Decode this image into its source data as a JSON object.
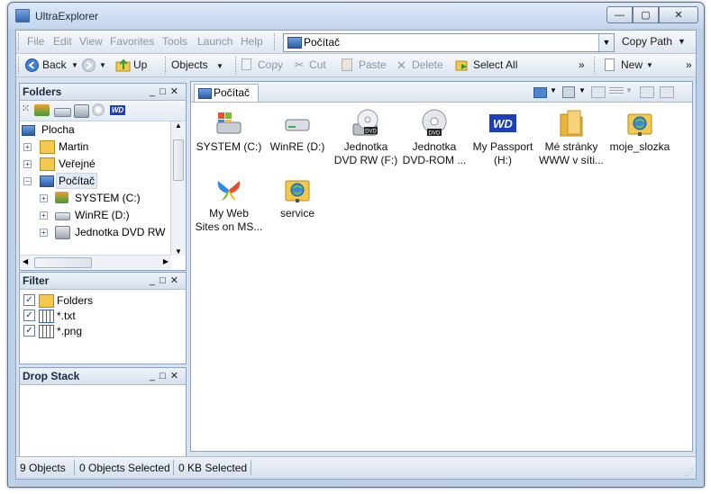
{
  "window": {
    "title": "UltraExplorer",
    "minimize": "—",
    "maximize": "▢",
    "close": "✕"
  },
  "menu": {
    "items": [
      "File",
      "Edit",
      "View",
      "Favorites",
      "Tools",
      "Launch",
      "Help"
    ]
  },
  "address": {
    "value": "Počítač",
    "copy_path": "Copy Path",
    "dropdown": "▼"
  },
  "toolbar": {
    "back": "Back",
    "up": "Up",
    "objects": "Objects",
    "copy": "Copy",
    "cut": "Cut",
    "paste": "Paste",
    "delete": "Delete",
    "select_all": "Select All",
    "new": "New",
    "more": "»"
  },
  "folders_panel": {
    "title": "Folders",
    "nodes": [
      {
        "label": "Plocha",
        "icon": "desktop-icon"
      },
      {
        "label": "Martin",
        "icon": "user-folder-icon"
      },
      {
        "label": "Veřejné",
        "icon": "folder-icon"
      },
      {
        "label": "Počítač",
        "icon": "computer-icon"
      },
      {
        "label": "SYSTEM (C:)",
        "icon": "windows-drive-icon"
      },
      {
        "label": "WinRE (D:)",
        "icon": "drive-icon"
      },
      {
        "label": "Jednotka DVD RW",
        "icon": "dvd-drive-icon"
      }
    ]
  },
  "filter_panel": {
    "title": "Filter",
    "items": [
      {
        "label": "Folders",
        "checked": true,
        "icon": "folder-icon"
      },
      {
        "label": "*.txt",
        "checked": true,
        "icon": "grid-icon"
      },
      {
        "label": "*.png",
        "checked": true,
        "icon": "grid-icon"
      }
    ]
  },
  "drop_stack_panel": {
    "title": "Drop Stack"
  },
  "panel_buttons": {
    "minimize": "_",
    "restore": "□",
    "close": "✕"
  },
  "content": {
    "tab": "Počítač",
    "items": [
      {
        "line1": "SYSTEM (C:)",
        "line2": "",
        "icon": "windows-drive-icon"
      },
      {
        "line1": "WinRE (D:)",
        "line2": "",
        "icon": "drive-icon"
      },
      {
        "line1": "Jednotka",
        "line2": "DVD RW (F:)",
        "icon": "dvd-rw-icon"
      },
      {
        "line1": "Jednotka",
        "line2": "DVD-ROM ...",
        "icon": "dvd-rom-icon"
      },
      {
        "line1": "My Passport",
        "line2": "(H:)",
        "icon": "wd-drive-icon"
      },
      {
        "line1": "Mé stránky",
        "line2": "WWW v síti...",
        "icon": "web-folder-icon"
      },
      {
        "line1": "moje_slozka",
        "line2": "",
        "icon": "network-folder-icon"
      },
      {
        "line1": "My Web",
        "line2": "Sites on MS...",
        "icon": "msn-butterfly-icon"
      },
      {
        "line1": "service",
        "line2": "",
        "icon": "network-folder-icon"
      }
    ]
  },
  "status": {
    "objects": "9 Objects",
    "selected": "0 Objects Selected",
    "kb": "0 KB Selected"
  },
  "colors": {
    "accent": "#2f66b4",
    "frame": "#bcd0e8",
    "folder": "#f2c94c",
    "wd": "#1d3fb8"
  }
}
